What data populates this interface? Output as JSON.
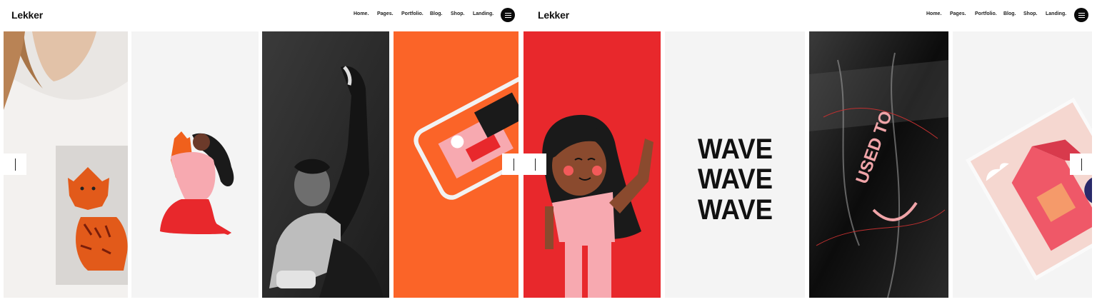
{
  "left": {
    "logo": "Lekker",
    "nav": [
      "Home.",
      "Pages.",
      "Portfolio.",
      "Blog.",
      "Shop.",
      "Landing."
    ]
  },
  "right": {
    "logo": "Lekker",
    "nav": [
      "Home.",
      "Pages.",
      "Portfolio.",
      "Blog.",
      "Shop.",
      "Landing."
    ]
  },
  "colors": {
    "orange": "#fb6428",
    "red": "#e8282c",
    "pink": "#f7a9b0",
    "dark": "#0a0a0a"
  },
  "artwork": {
    "wave_text": "WAVE",
    "poster_text": "USED TO"
  }
}
